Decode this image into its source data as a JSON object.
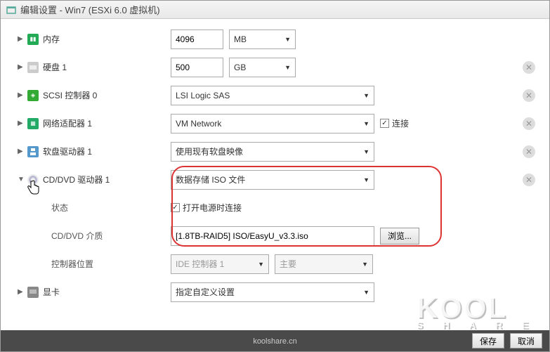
{
  "title": "编辑设置 - Win7 (ESXi 6.0 虚拟机)",
  "rows": {
    "memory": {
      "label": "内存",
      "value": "4096",
      "unit": "MB"
    },
    "hdd": {
      "label": "硬盘 1",
      "value": "500",
      "unit": "GB"
    },
    "scsi": {
      "label": "SCSI 控制器 0",
      "value": "LSI Logic SAS"
    },
    "net": {
      "label": "网络适配器 1",
      "value": "VM Network",
      "connect": "连接",
      "connect_checked": true
    },
    "floppy": {
      "label": "软盘驱动器 1",
      "value": "使用现有软盘映像"
    },
    "cd": {
      "label": "CD/DVD 驱动器 1",
      "value": "数据存储 ISO 文件",
      "status_label": "状态",
      "status_check_label": "打开电源时连接",
      "status_checked": true,
      "media_label": "CD/DVD 介质",
      "media_path": "[1.8TB-RAID5] ISO/EasyU_v3.3.iso",
      "browse": "浏览...",
      "ctrl_label": "控制器位置",
      "ctrl_val": "IDE 控制器 1",
      "ctrl_pos": "主要"
    },
    "gpu": {
      "label": "显卡",
      "value": "指定自定义设置"
    }
  },
  "footer": {
    "save": "保存",
    "cancel": "取消"
  },
  "watermark": {
    "brand": "KOOL",
    "sub": "S H A R E",
    "url": "koolshare.cn"
  }
}
